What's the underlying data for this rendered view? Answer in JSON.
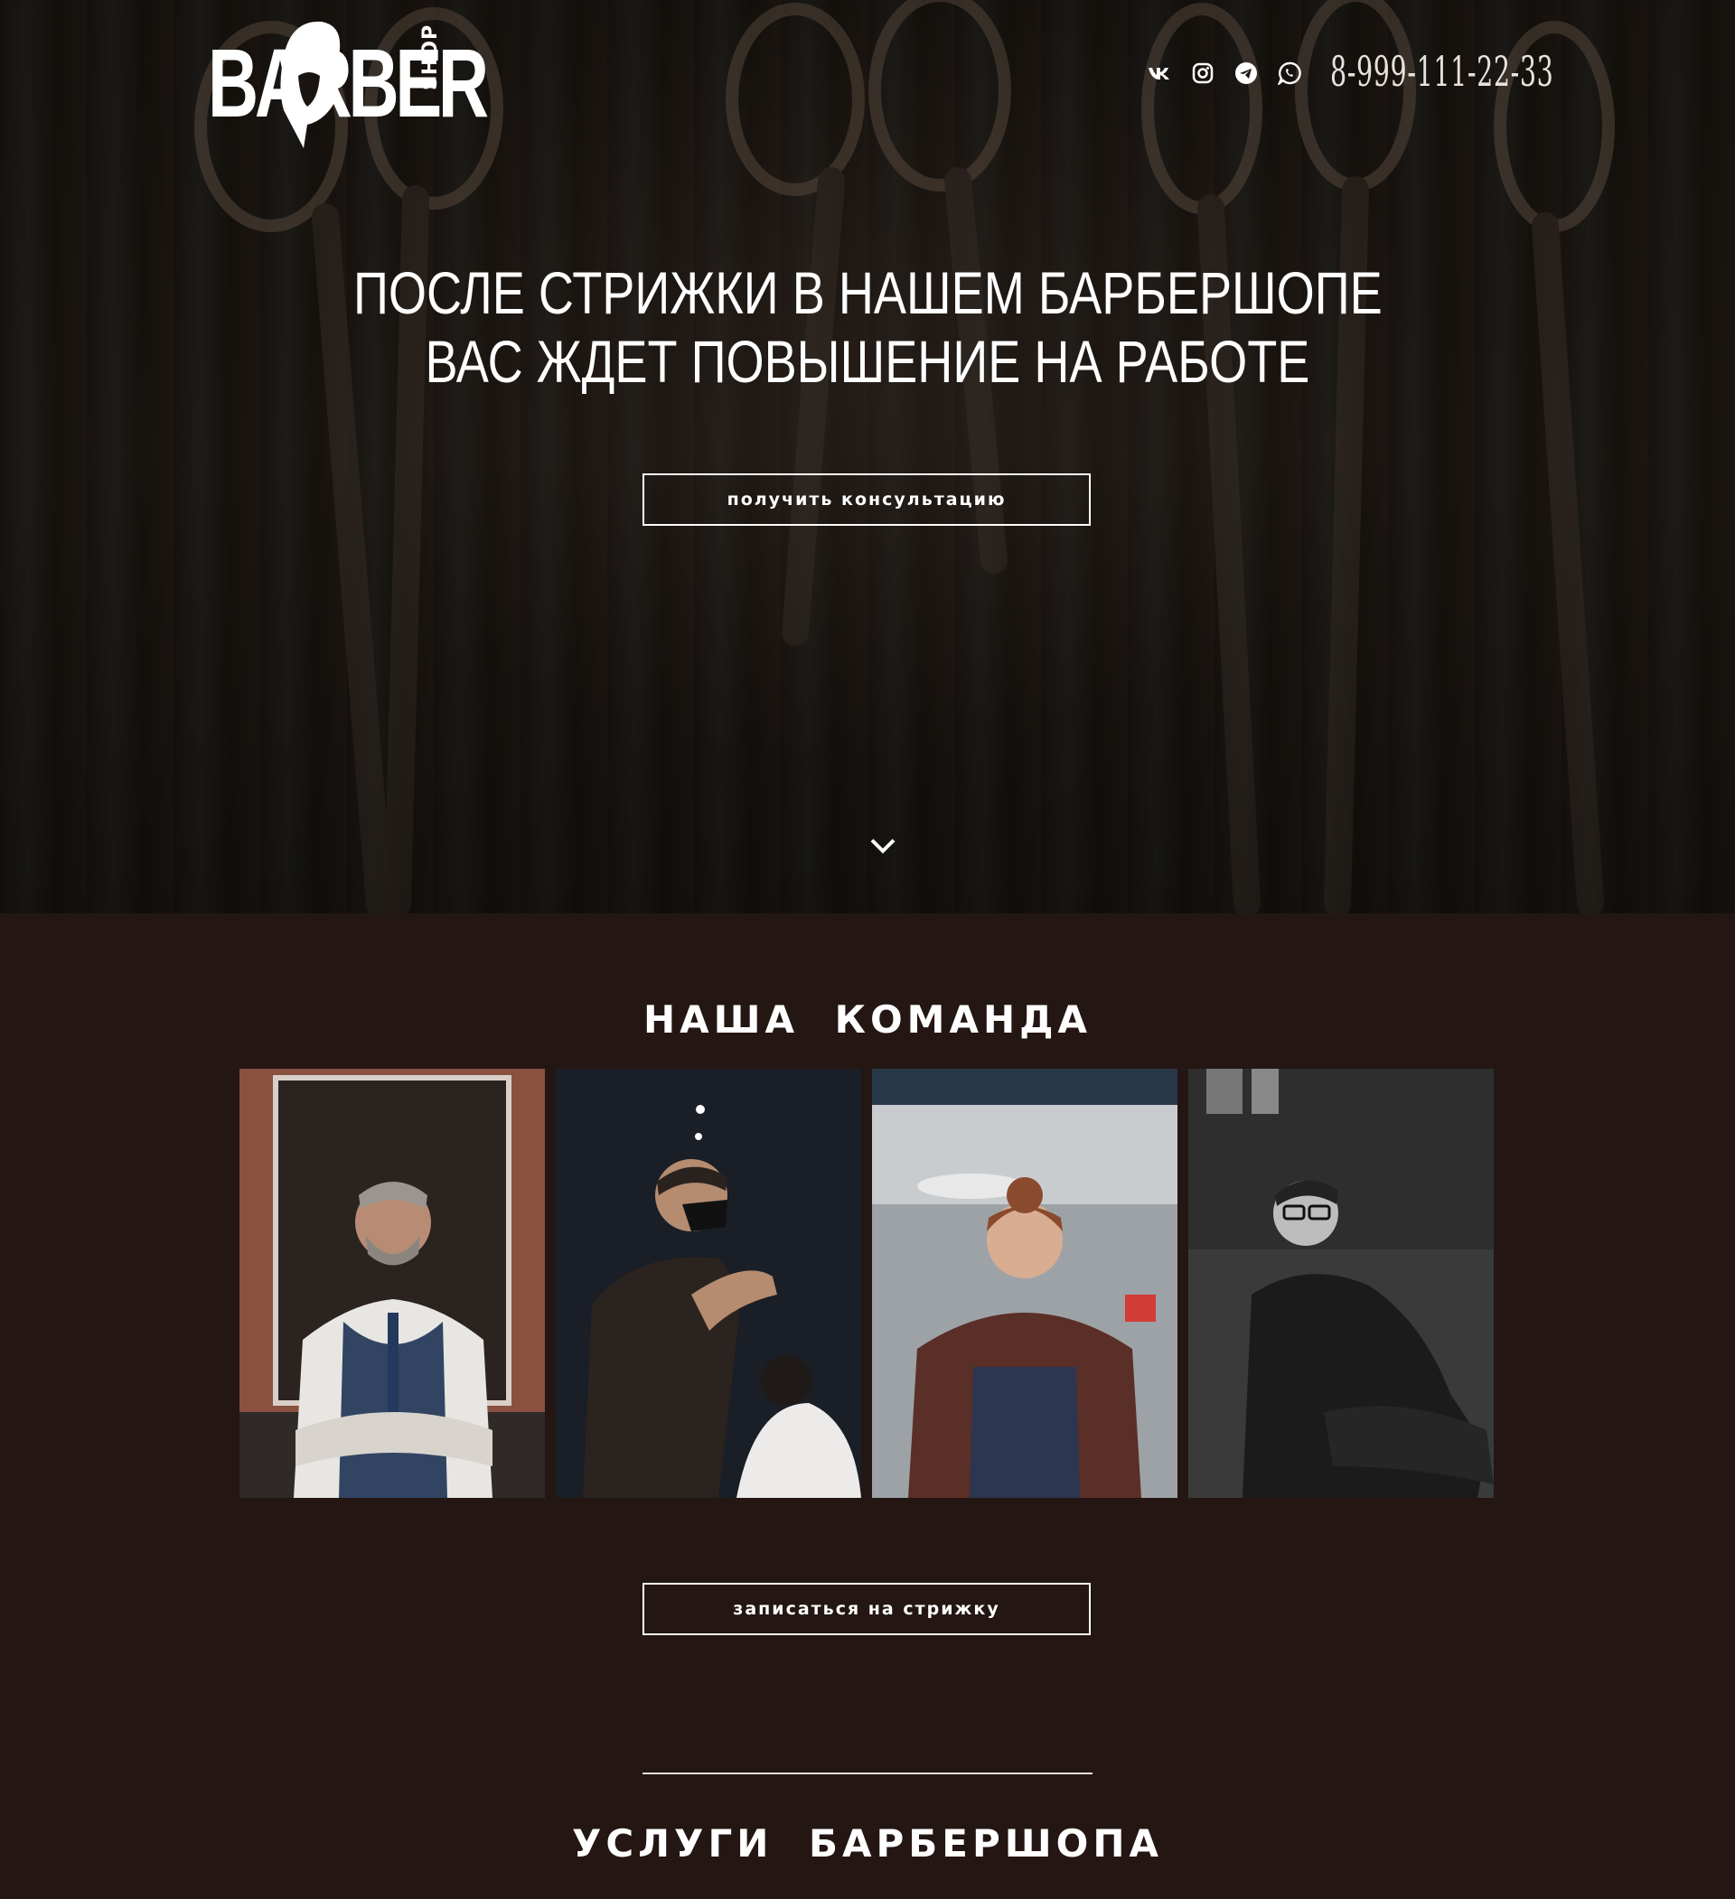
{
  "header": {
    "logo": {
      "word": "BARBER",
      "sub": "SHOP"
    },
    "socials": [
      "vk-icon",
      "instagram-icon",
      "telegram-icon",
      "whatsapp-icon"
    ],
    "phone": "8-999-111-22-33"
  },
  "hero": {
    "title_line1": "ПОСЛЕ СТРИЖКИ В НАШЕМ БАРБЕРШОПЕ",
    "title_line2": "ВАС ЖДЕТ ПОВЫШЕНИЕ НА РАБОТЕ",
    "cta": "получить консультацию"
  },
  "team": {
    "title": "НАША КОМАНДА",
    "members": [
      {
        "photo": "barber-photo-1"
      },
      {
        "photo": "barber-photo-2"
      },
      {
        "photo": "barber-photo-3"
      },
      {
        "photo": "barber-photo-4"
      }
    ],
    "cta": "записаться на стрижку"
  },
  "services": {
    "title": "УСЛУГИ БАРБЕРШОПА"
  },
  "colors": {
    "background": "#241612",
    "hero_dark": "#1b1512",
    "text": "#ffffff"
  }
}
